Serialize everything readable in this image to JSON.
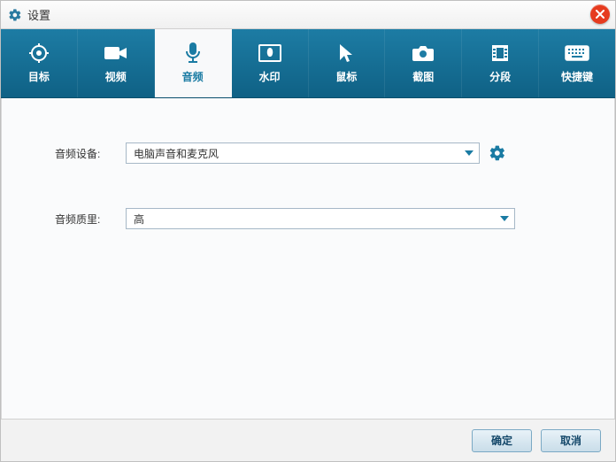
{
  "window": {
    "title": "设置"
  },
  "tabs": [
    {
      "label": "目标"
    },
    {
      "label": "视频"
    },
    {
      "label": "音频"
    },
    {
      "label": "水印"
    },
    {
      "label": "鼠标"
    },
    {
      "label": "截图"
    },
    {
      "label": "分段"
    },
    {
      "label": "快捷键"
    }
  ],
  "audio": {
    "device_label": "音频设备:",
    "device_value": "电脑声音和麦克风",
    "quality_label": "音频质里:",
    "quality_value": "高"
  },
  "footer": {
    "ok": "确定",
    "cancel": "取消"
  }
}
